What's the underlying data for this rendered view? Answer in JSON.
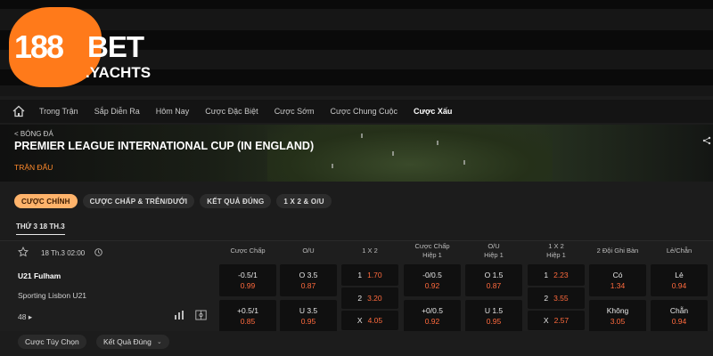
{
  "brand": {
    "num": "188",
    "bet": "BET",
    "domain": ".YACHTS",
    "accent": "#ff7a1a"
  },
  "nav": {
    "items": [
      "Trong Trận",
      "Sắp Diễn Ra",
      "Hôm Nay",
      "Cược Đặc Biệt",
      "Cược Sớm",
      "Cược Chung Cuộc",
      "Cược Xấu"
    ],
    "active": "Cược Xấu"
  },
  "banner": {
    "back": "< BÓNG ĐÁ",
    "league": "PREMIER LEAGUE INTERNATIONAL CUP (IN ENGLAND)",
    "subtitle": "TRẬN ĐẤU"
  },
  "pills": [
    "CƯỢC CHÍNH",
    "CƯỢC CHẤP & TRÊN/DƯỚI",
    "KẾT QUẢ ĐÚNG",
    "1 X 2 & O/U"
  ],
  "date_tab": "THỨ 3 18 TH.3",
  "match": {
    "kickoff": "18 Th.3 02:00",
    "home": "U21 Fulham",
    "away": "Sporting Lisbon U21",
    "more": "48 ▸"
  },
  "columns": [
    {
      "h1": "Cược Chấp",
      "h2": ""
    },
    {
      "h1": "O/U",
      "h2": ""
    },
    {
      "h1": "1 X 2",
      "h2": ""
    },
    {
      "h1": "Cược Chấp",
      "h2": "Hiệp 1"
    },
    {
      "h1": "O/U",
      "h2": "Hiệp 1"
    },
    {
      "h1": "1 X 2",
      "h2": "Hiệp 1"
    },
    {
      "h1": "2 Đội Ghi Bàn",
      "h2": ""
    },
    {
      "h1": "Lẻ/Chẵn",
      "h2": ""
    }
  ],
  "odds": {
    "row1": [
      {
        "a": "-0.5/1",
        "o": "0.99"
      },
      {
        "a": "O 3.5",
        "o": "0.87"
      },
      {
        "a": "1",
        "o": "1.70"
      },
      {
        "a": "-0/0.5",
        "o": "0.92"
      },
      {
        "a": "O 1.5",
        "o": "0.87"
      },
      {
        "a": "1",
        "o": "2.23"
      },
      {
        "a": "Có",
        "o": "1.34"
      },
      {
        "a": "Lẻ",
        "o": "0.94"
      }
    ],
    "row2": [
      {
        "a": "+0.5/1",
        "o": "0.85"
      },
      {
        "a": "U 3.5",
        "o": "0.95"
      },
      {
        "a": "X",
        "o": "4.05"
      },
      {
        "a": "+0/0.5",
        "o": "0.92"
      },
      {
        "a": "U 1.5",
        "o": "0.95"
      },
      {
        "a": "X",
        "o": "2.57"
      },
      {
        "a": "Không",
        "o": "3.05"
      },
      {
        "a": "Chẵn",
        "o": "0.94"
      }
    ],
    "draw": [
      {
        "a": "2",
        "o": "3.20"
      },
      {
        "a": "2",
        "o": "3.55"
      }
    ]
  },
  "bottom": {
    "custom": "Cược Tùy Chọn",
    "correct_score": "Kết Quả Đúng"
  }
}
